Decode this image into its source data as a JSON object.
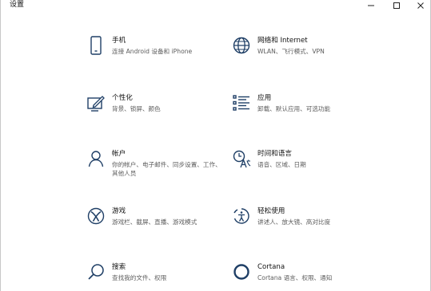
{
  "window": {
    "title": "设置"
  },
  "tiles": [
    {
      "name": "手机",
      "desc": "连接 Android 设备和 iPhone",
      "icon": "phone-icon"
    },
    {
      "name": "网络和 Internet",
      "desc": "WLAN、飞行模式、VPN",
      "icon": "globe-icon"
    },
    {
      "name": "个性化",
      "desc": "背景、锁屏、颜色",
      "icon": "personalization-icon"
    },
    {
      "name": "应用",
      "desc": "卸载、默认应用、可选功能",
      "icon": "apps-list-icon"
    },
    {
      "name": "帐户",
      "desc": "你的帐户、电子邮件、同步设置、工作、其他人员",
      "icon": "person-icon"
    },
    {
      "name": "时间和语言",
      "desc": "语音、区域、日期",
      "icon": "time-language-icon"
    },
    {
      "name": "游戏",
      "desc": "游戏栏、截屏、直播、游戏模式",
      "icon": "xbox-icon"
    },
    {
      "name": "轻松使用",
      "desc": "讲述人、放大镜、高对比度",
      "icon": "ease-of-access-icon"
    },
    {
      "name": "搜索",
      "desc": "查找我的文件、权限",
      "icon": "search-icon"
    },
    {
      "name": "Cortana",
      "desc": "Cortana 语言、权限、通知",
      "icon": "cortana-icon"
    }
  ]
}
